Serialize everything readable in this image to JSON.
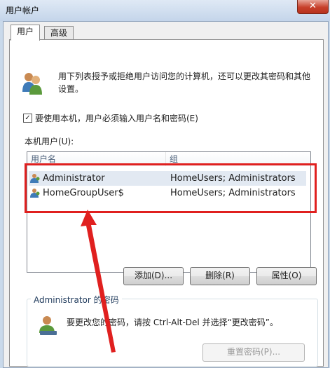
{
  "window": {
    "title": "用户帐户",
    "close_glyph": "✕"
  },
  "tabs": [
    {
      "label": "用户"
    },
    {
      "label": "高级"
    }
  ],
  "intro": {
    "text": "用下列表授予或拒绝用户访问您的计算机，还可以更改其密码和其他设置。"
  },
  "require_login": {
    "checked": true,
    "label": "要使用本机，用户必须输入用户名和密码(E)"
  },
  "users_section": {
    "label": "本机用户(U):"
  },
  "users_table": {
    "columns": [
      "用户名",
      "组"
    ],
    "rows": [
      {
        "name": "Administrator",
        "group": "HomeUsers; Administrators"
      },
      {
        "name": "HomeGroupUser$",
        "group": "HomeUsers; Administrators"
      }
    ]
  },
  "buttons": {
    "add": "添加(D)...",
    "remove": "删除(R)",
    "properties": "属性(O)"
  },
  "password_group": {
    "title": "Administrator 的密码",
    "text": "要更改您的密码，请按 Ctrl-Alt-Del 并选择“更改密码”。",
    "reset_button": "重置密码(P)..."
  },
  "annotation_color": "#e0201f"
}
